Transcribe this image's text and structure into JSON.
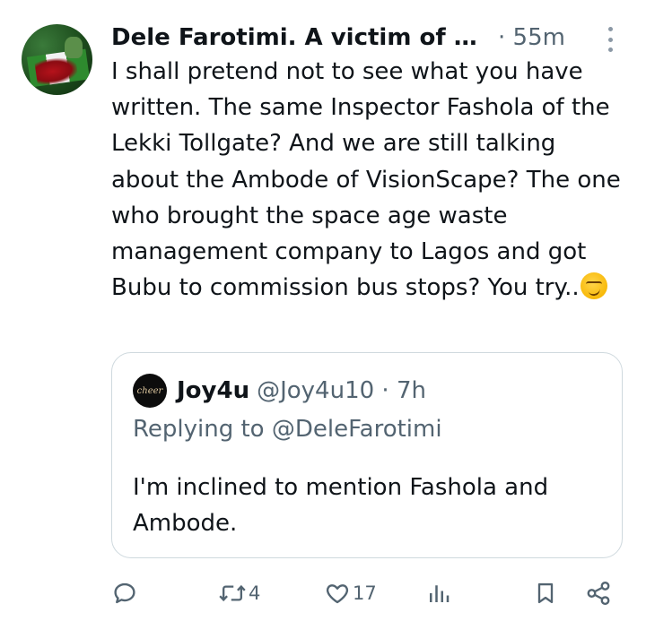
{
  "tweet": {
    "author_name": "Dele Farotimi. A victim of Ni...",
    "time": "· 55m",
    "text": "I shall pretend not to see what you have written. The same Inspector Fashola of the Lekki Tollgate? And we are still talking about the Ambode of VisionScape? The one who brought the space age waste management company to Lagos and got Bubu to commission bus stops? You try..",
    "emoji_icon": "smirking-face-emoji"
  },
  "quoted_tweet": {
    "author_name": "Joy4u",
    "handle_time": "@Joy4u10 · 7h",
    "avatar_text": "cheer",
    "replying_to": "Replying to @DeleFarotimi",
    "text": "I'm inclined to mention Fashola and Ambode."
  },
  "actions": {
    "reply_icon": "reply-icon",
    "retweet_icon": "retweet-icon",
    "retweet_count": "4",
    "like_icon": "heart-icon",
    "like_count": "17",
    "views_icon": "analytics-icon",
    "bookmark_icon": "bookmark-icon",
    "share_icon": "share-icon"
  },
  "colors": {
    "text": "#0f1419",
    "secondary": "#536471",
    "border": "#cfd9de"
  }
}
